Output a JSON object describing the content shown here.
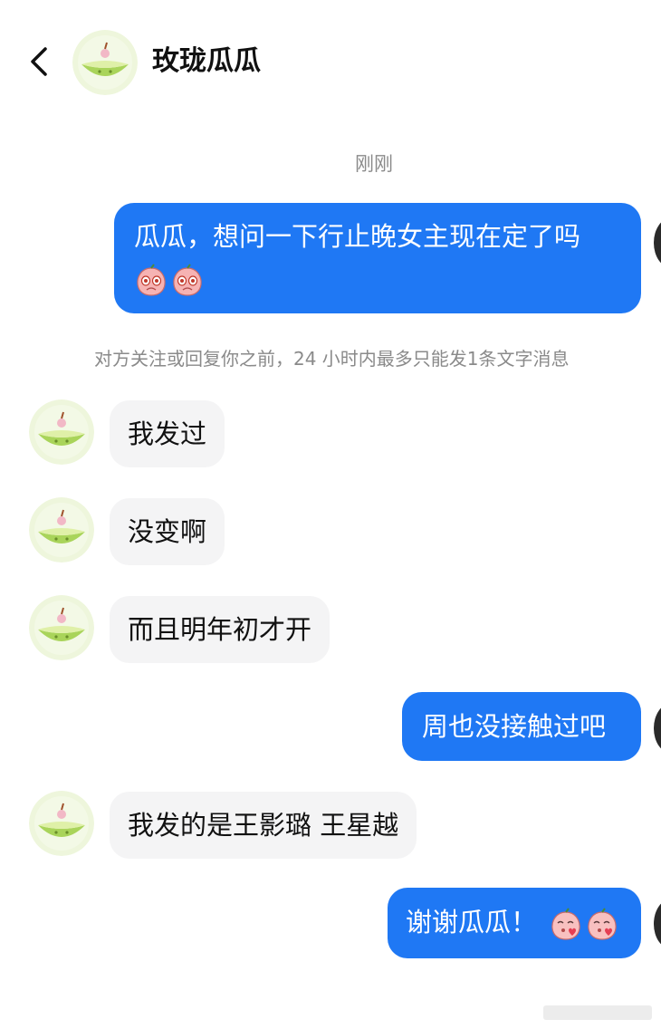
{
  "header": {
    "title": "玫珑瓜瓜"
  },
  "timestamp": "刚刚",
  "system_note": "对方关注或回复你之前，24 小时内最多只能发1条文字消息",
  "messages": [
    {
      "text": "瓜瓜，想问一下行止晚女主现在定了吗",
      "emoji": [
        "crying-peach-emoji",
        "crying-peach-emoji"
      ]
    },
    {
      "text": "我发过"
    },
    {
      "text": "没变啊"
    },
    {
      "text": "而且明年初才开"
    },
    {
      "text": "周也没接触过吧"
    },
    {
      "text": "我发的是王影璐 王星越"
    },
    {
      "text": "谢谢瓜瓜！",
      "emoji": [
        "kissing-peach-emoji",
        "kissing-peach-emoji"
      ]
    }
  ],
  "colors": {
    "outgoing_bubble": "#1f78f4",
    "incoming_bubble": "#f4f4f5",
    "meta_text": "#8a8a8a"
  }
}
